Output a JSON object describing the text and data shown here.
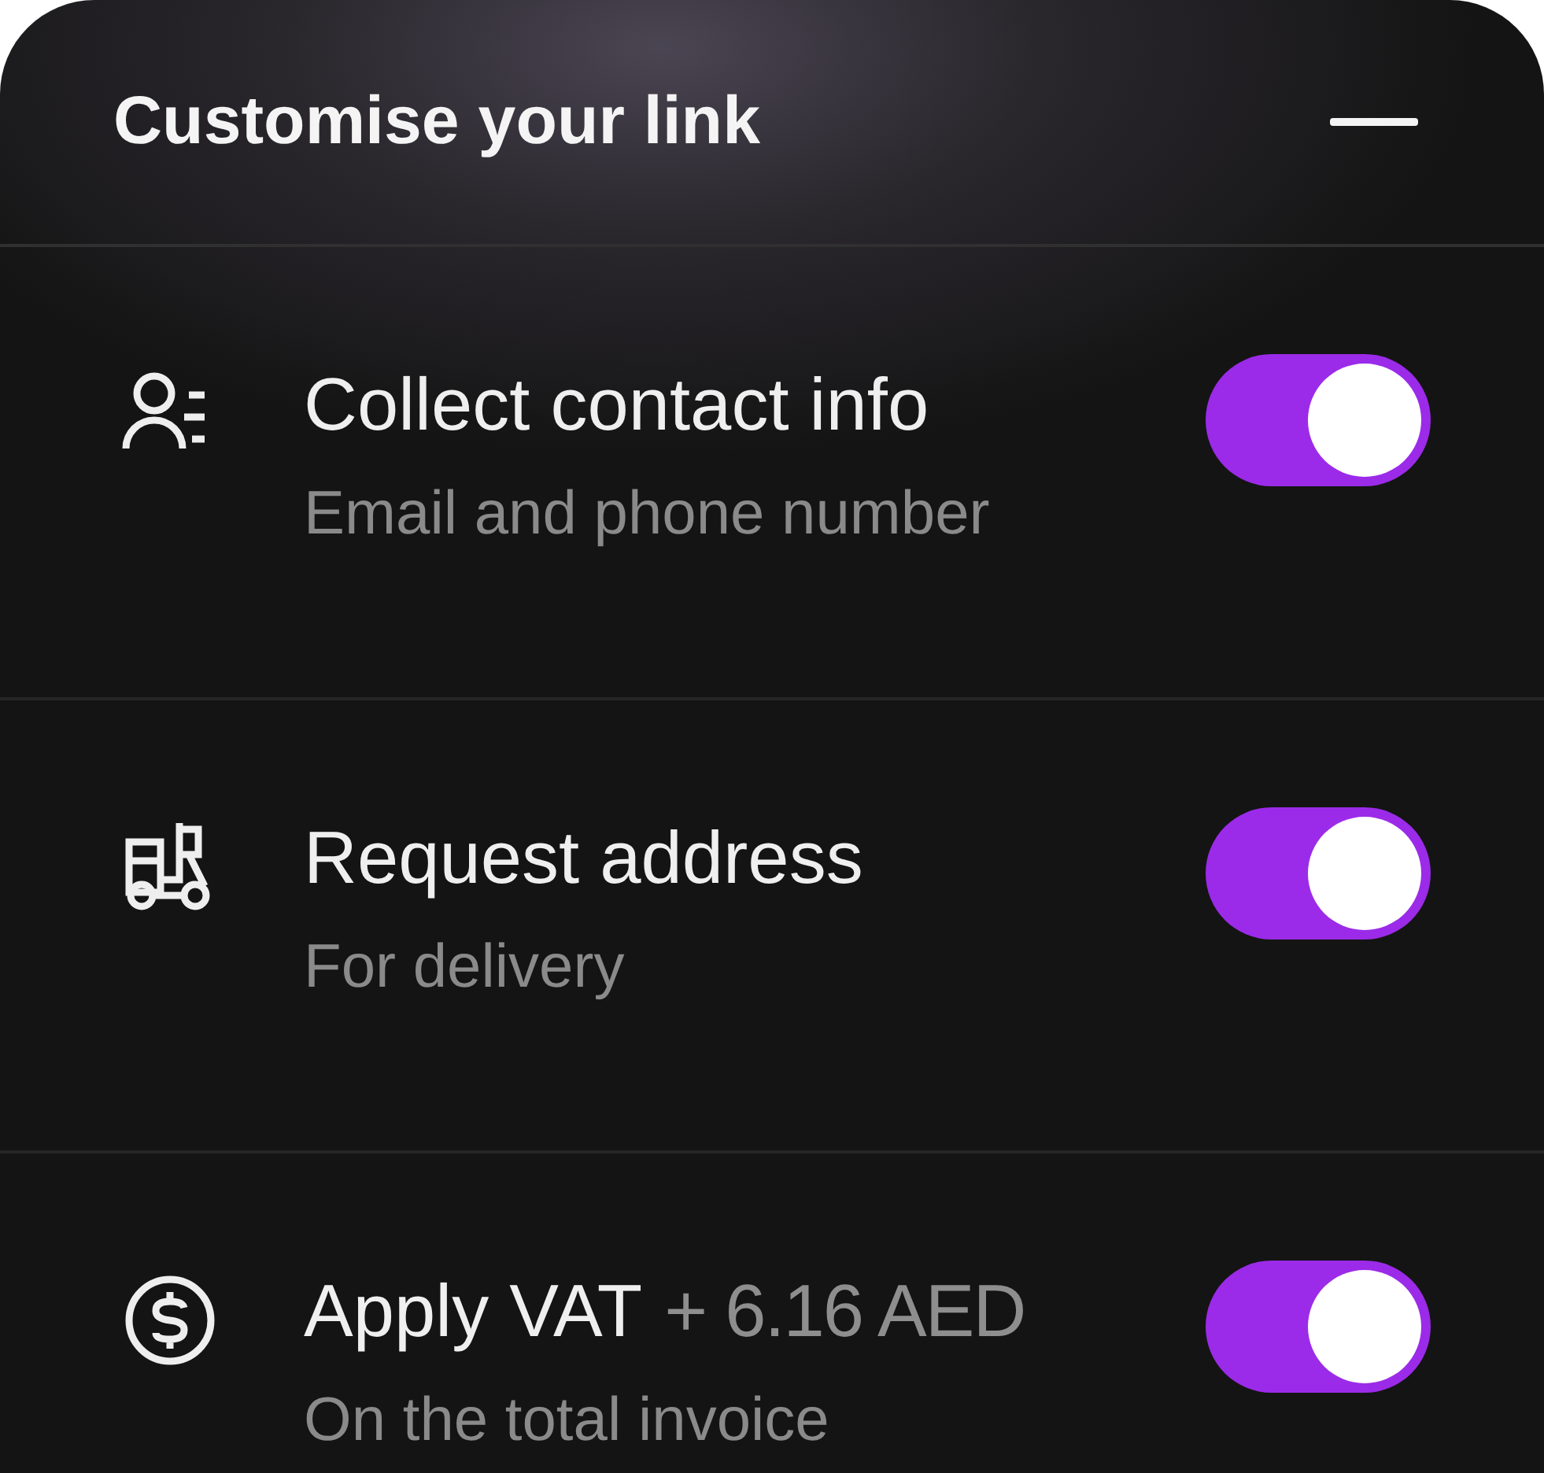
{
  "header": {
    "title": "Customise your link"
  },
  "options": [
    {
      "kind": "contact",
      "title": "Collect contact info",
      "subtitle": "Email and phone number",
      "on": true
    },
    {
      "kind": "address",
      "title": "Request address",
      "subtitle": "For delivery",
      "on": true
    },
    {
      "kind": "vat",
      "title": "Apply VAT",
      "amount": "+ 6.16 AED",
      "subtitle": "On the total invoice",
      "on": true
    }
  ]
}
